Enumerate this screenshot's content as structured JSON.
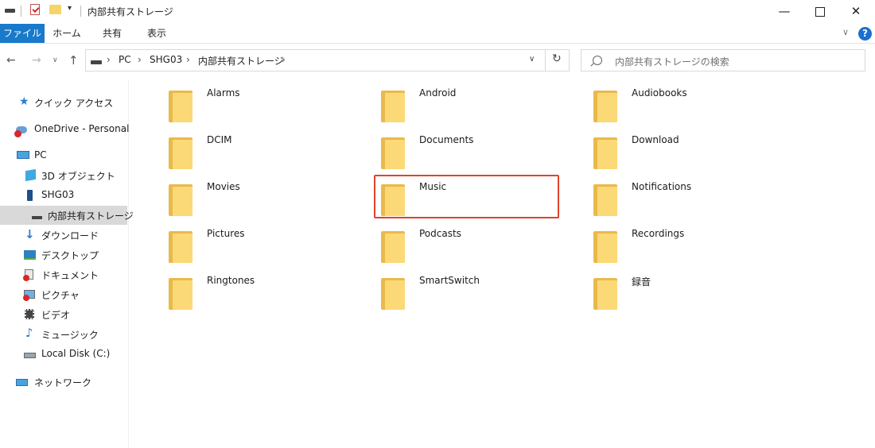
{
  "window": {
    "title": "内部共有ストレージ",
    "controls": {
      "minimize": "—",
      "maximize": "☐",
      "close": "✕"
    }
  },
  "ribbon": {
    "tabs": [
      "ファイル",
      "ホーム",
      "共有",
      "表示"
    ],
    "help": "?"
  },
  "navigation": {
    "back": "←",
    "forward": "→",
    "recent": "∨",
    "up": "↑",
    "breadcrumbs": [
      "PC",
      "SHG03",
      "内部共有ストレージ"
    ],
    "separator": "›",
    "dropdown": "∨",
    "refresh": "↻"
  },
  "search": {
    "placeholder": "内部共有ストレージの検索"
  },
  "sidebar": {
    "items": [
      {
        "label": "クイック アクセス",
        "icon": "star-icon"
      },
      {
        "label": "OneDrive - Personal",
        "icon": "cloud-icon"
      },
      {
        "label": "PC",
        "icon": "monitor-icon"
      },
      {
        "label": "3D オブジェクト",
        "icon": "cube-icon"
      },
      {
        "label": "SHG03",
        "icon": "phone-icon"
      },
      {
        "label": "内部共有ストレージ",
        "icon": "drive-icon",
        "selected": true
      },
      {
        "label": "ダウンロード",
        "icon": "download-icon"
      },
      {
        "label": "デスクトップ",
        "icon": "desktop-icon"
      },
      {
        "label": "ドキュメント",
        "icon": "document-icon"
      },
      {
        "label": "ピクチャ",
        "icon": "picture-icon"
      },
      {
        "label": "ビデオ",
        "icon": "video-icon"
      },
      {
        "label": "ミュージック",
        "icon": "music-icon"
      },
      {
        "label": "Local Disk (C:)",
        "icon": "disk-icon"
      },
      {
        "label": "ネットワーク",
        "icon": "network-icon"
      }
    ]
  },
  "folders": [
    "Alarms",
    "Android",
    "Audiobooks",
    "DCIM",
    "Documents",
    "Download",
    "Movies",
    "Music",
    "Notifications",
    "Pictures",
    "Podcasts",
    "Recordings",
    "Ringtones",
    "SmartSwitch",
    "録音"
  ],
  "highlighted_folder": "Music",
  "colors": {
    "accent": "#1979ca",
    "highlight": "#e0442a",
    "folder": "#fcd977"
  }
}
